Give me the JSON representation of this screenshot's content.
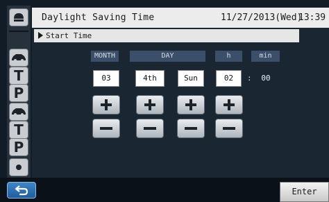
{
  "header": {
    "title": "Daylight Saving Time",
    "date": "11/27/2013(Wed)",
    "time": "13:39"
  },
  "section": {
    "label": "Start Time"
  },
  "columns": {
    "month": "MONTH",
    "day": "DAY",
    "hour": "h",
    "minute": "min"
  },
  "values": {
    "month": "03",
    "week": "4th",
    "weekday": "Sun",
    "hour": "02",
    "separator": ":",
    "minute": "00"
  },
  "rail": {
    "letters": [
      "T",
      "P",
      "T",
      "P"
    ]
  },
  "footer": {
    "enter_label": "Enter"
  },
  "icons": {
    "rail_top": "eject-icon",
    "rail_car1": "car-icon",
    "rail_car2": "car-icon",
    "rail_bottom": "dot-icon",
    "back": "back-arrow-icon"
  }
}
